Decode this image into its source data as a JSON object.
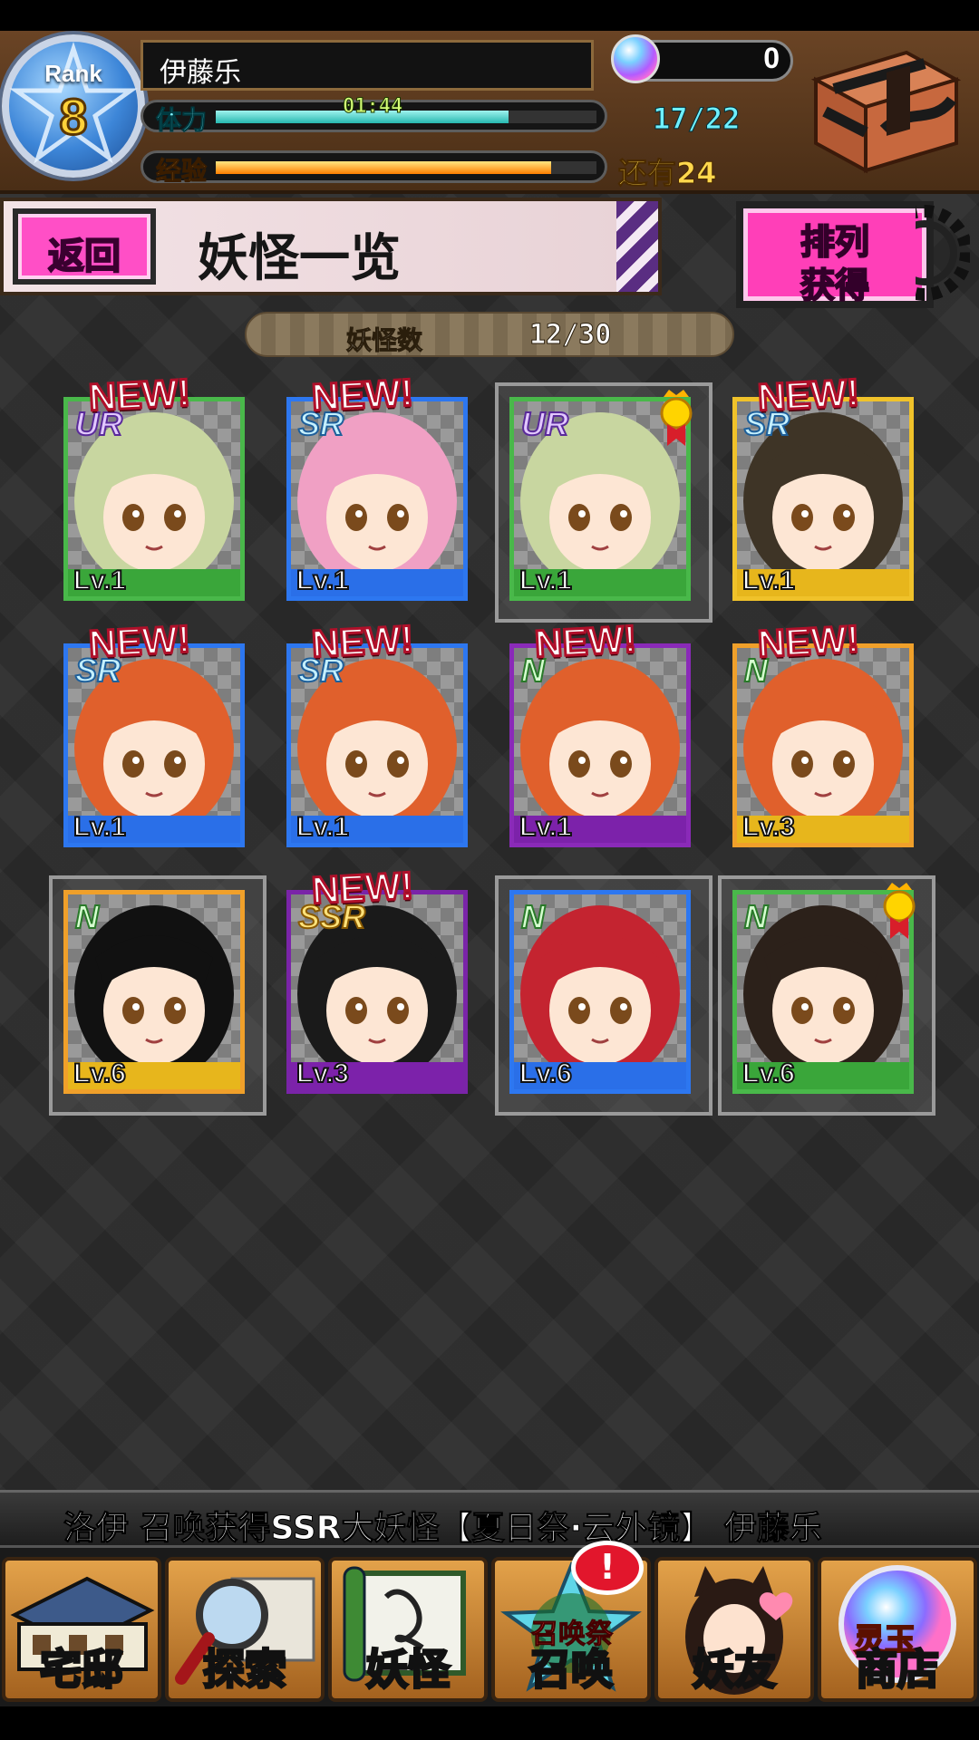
{
  "header": {
    "rank_label": "Rank",
    "rank_value": "8",
    "player_name": "伊藤乐",
    "gem_count": "0",
    "stamina_label": "体力",
    "stamina_timer": "01:44",
    "stamina_value": "17/22",
    "stamina_fraction": 0.77,
    "exp_label": "经验",
    "exp_remaining": "还有24",
    "exp_fraction": 0.88
  },
  "title_bar": {
    "back_label": "返回",
    "page_title": "妖怪一览",
    "sort_label_line1": "排列",
    "sort_label_line2": "获得"
  },
  "collection": {
    "count_label": "妖怪数",
    "count_value": "12/30"
  },
  "cards": [
    {
      "rarity": "UR",
      "level": "Lv.1",
      "is_new": true,
      "new_label": "NEW!",
      "frame": "#49b84a",
      "strip": "#3aa63a",
      "hair": "#c8d6a0",
      "selected": false,
      "medal": false
    },
    {
      "rarity": "SR",
      "level": "Lv.1",
      "is_new": true,
      "new_label": "NEW!",
      "frame": "#2d77f0",
      "strip": "#2a6fe8",
      "hair": "#f0a0c4",
      "selected": false,
      "medal": false
    },
    {
      "rarity": "UR",
      "level": "Lv.1",
      "is_new": false,
      "new_label": "",
      "frame": "#49b84a",
      "strip": "#3aa63a",
      "hair": "#c8d6a0",
      "selected": true,
      "medal": true
    },
    {
      "rarity": "SR",
      "level": "Lv.1",
      "is_new": true,
      "new_label": "NEW!",
      "frame": "#f0c22a",
      "strip": "#e7b61c",
      "hair": "#3e3426",
      "selected": false,
      "medal": false
    },
    {
      "rarity": "SR",
      "level": "Lv.1",
      "is_new": true,
      "new_label": "NEW!",
      "frame": "#2d77f0",
      "strip": "#2a6fe8",
      "hair": "#e0602c",
      "selected": false,
      "medal": false
    },
    {
      "rarity": "SR",
      "level": "Lv.1",
      "is_new": true,
      "new_label": "NEW!",
      "frame": "#2d77f0",
      "strip": "#2a6fe8",
      "hair": "#e0602c",
      "selected": false,
      "medal": false
    },
    {
      "rarity": "N",
      "level": "Lv.1",
      "is_new": true,
      "new_label": "NEW!",
      "frame": "#8a2ab8",
      "strip": "#7c22aa",
      "hair": "#e0602c",
      "selected": false,
      "medal": false
    },
    {
      "rarity": "N",
      "level": "Lv.3",
      "is_new": true,
      "new_label": "NEW!",
      "frame": "#f0a02a",
      "strip": "#e7b61c",
      "hair": "#e0602c",
      "selected": false,
      "medal": false
    },
    {
      "rarity": "N",
      "level": "Lv.6",
      "is_new": false,
      "new_label": "",
      "frame": "#f0a02a",
      "strip": "#e7b61c",
      "hair": "#111111",
      "selected": true,
      "medal": false
    },
    {
      "rarity": "SSR",
      "level": "Lv.3",
      "is_new": true,
      "new_label": "NEW!",
      "frame": "#7a24a8",
      "strip": "#7c22aa",
      "hair": "#1a1a1a",
      "selected": false,
      "medal": false
    },
    {
      "rarity": "N",
      "level": "Lv.6",
      "is_new": false,
      "new_label": "",
      "frame": "#2d77f0",
      "strip": "#2a6fe8",
      "hair": "#c42430",
      "selected": true,
      "medal": false
    },
    {
      "rarity": "N",
      "level": "Lv.6",
      "is_new": false,
      "new_label": "",
      "frame": "#49b84a",
      "strip": "#3aa63a",
      "hair": "#2c211a",
      "selected": true,
      "medal": true
    }
  ],
  "ticker": {
    "text": "洛伊 召唤获得SSR大妖怪【夏日祭·云外镜】  伊藤乐"
  },
  "nav": {
    "items": [
      {
        "label": "宅邸",
        "icon": "house-icon"
      },
      {
        "label": "探索",
        "icon": "magnifier-map-icon"
      },
      {
        "label": "妖怪",
        "icon": "scroll-icon"
      },
      {
        "label": "召唤",
        "icon": "summon-star-icon",
        "tag": "召唤祭"
      },
      {
        "label": "妖友",
        "icon": "fox-girl-icon"
      },
      {
        "label": "商店",
        "icon": "spirit-orb-icon",
        "tag": "灵玉"
      }
    ],
    "alert_mark": "!"
  },
  "colors": {
    "accent_pink": "#ff4fc6",
    "stamina": "#26b8b0",
    "exp": "#ff7f00",
    "header_brown": "#6a4425"
  }
}
